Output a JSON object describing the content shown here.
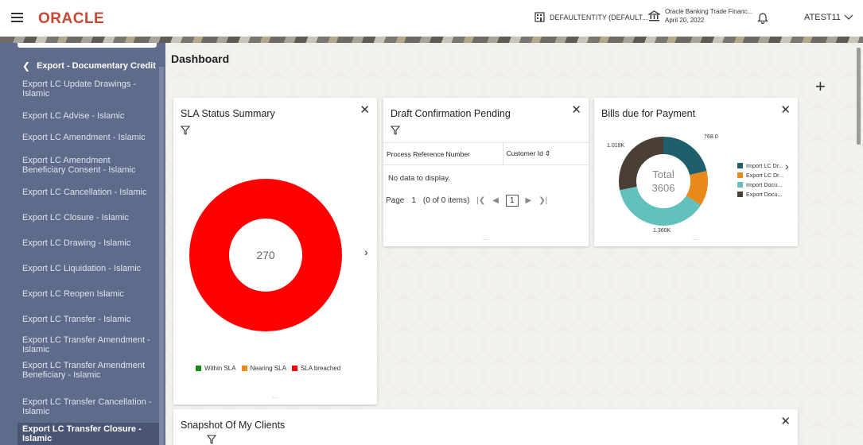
{
  "header": {
    "logo": "ORACLE",
    "entity": "DEFAULTENTITY (DEFAULT...",
    "bank_name": "Oracle Banking Trade Financ...",
    "bank_date": "April 20, 2022",
    "user": "ATEST11"
  },
  "sidebar": {
    "title": "Export - Documentary Credit",
    "items": [
      {
        "label": "Export LC Update Drawings - Islamic"
      },
      {
        "label": "Export LC Advise - Islamic"
      },
      {
        "label": "Export LC Amendment - Islamic"
      },
      {
        "label": "Export LC Amendment Beneficiary Consent - Islamic"
      },
      {
        "label": "Export LC Cancellation - Islamic"
      },
      {
        "label": "Export LC Closure - Islamic"
      },
      {
        "label": "Export LC Drawing - Islamic"
      },
      {
        "label": "Export LC Liquidation - Islamic"
      },
      {
        "label": "Export LC Reopen Islamic"
      },
      {
        "label": "Export LC Transfer - Islamic"
      },
      {
        "label": "Export LC Transfer Amendment - Islamic"
      },
      {
        "label": "Export LC Transfer Amendment Beneficiary - Islamic"
      },
      {
        "label": "Export LC Transfer Cancellation - Islamic"
      },
      {
        "label": "Export LC Transfer Closure - Islamic"
      }
    ]
  },
  "main": {
    "title": "Dashboard",
    "add_icon": "plus-icon"
  },
  "sla": {
    "title": "SLA Status Summary",
    "center_value": "270",
    "legend": [
      {
        "label": "Within SLA",
        "color": "#1a8a1a"
      },
      {
        "label": "Nearing SLA",
        "color": "#f28c13"
      },
      {
        "label": "SLA breached",
        "color": "#ff0000"
      }
    ],
    "donut_color": "#ff0000"
  },
  "draft": {
    "title": "Draft Confirmation Pending",
    "columns": [
      "Process Reference Number",
      "Customer Id"
    ],
    "empty_text": "No data to display.",
    "pager": {
      "page_label": "Page",
      "page_num": "1",
      "items": "(0 of 0 items)",
      "current": "1"
    }
  },
  "bills": {
    "title": "Bills due for Payment",
    "total_label": "Total",
    "total_value": "3606",
    "slice_labels": [
      "768.0",
      "1.018K",
      "1.360K"
    ],
    "legend": [
      {
        "label": "Import LC Dr...",
        "color": "#1f5f6b"
      },
      {
        "label": "Export LC Dr...",
        "color": "#e8891c"
      },
      {
        "label": "Import Docu...",
        "color": "#62c0bd"
      },
      {
        "label": "Export Docu...",
        "color": "#4a3f35"
      }
    ]
  },
  "snapshot": {
    "title": "Snapshot Of My Clients"
  },
  "chart_data": {
    "type": "pie",
    "title": "Bills due for Payment",
    "categories": [
      "Import LC Dr...",
      "Export LC Dr...",
      "Import Docu...",
      "Export Docu..."
    ],
    "values": [
      768.0,
      460,
      1360,
      1018
    ],
    "total": 3606
  }
}
